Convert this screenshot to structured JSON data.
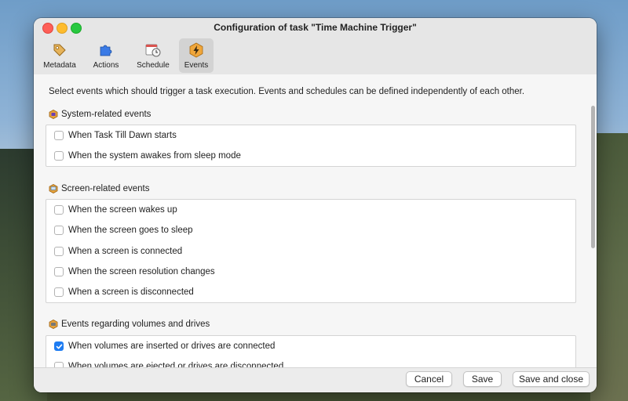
{
  "window": {
    "title": "Configuration of task \"Time Machine Trigger\""
  },
  "tabs": [
    {
      "label": "Metadata",
      "icon": "tag-icon"
    },
    {
      "label": "Actions",
      "icon": "puzzle-icon"
    },
    {
      "label": "Schedule",
      "icon": "calendar-clock-icon"
    },
    {
      "label": "Events",
      "icon": "lightning-icon",
      "active": true
    }
  ],
  "intro": "Select events which should trigger a task execution. Events and schedules can be defined independently of each other.",
  "sections": [
    {
      "title": "System-related events",
      "items": [
        {
          "label": "When Task Till Dawn starts",
          "checked": false
        },
        {
          "label": "When the system awakes from sleep mode",
          "checked": false
        }
      ]
    },
    {
      "title": "Screen-related events",
      "items": [
        {
          "label": "When the screen wakes up",
          "checked": false
        },
        {
          "label": "When the screen goes to sleep",
          "checked": false
        },
        {
          "label": "When a screen is connected",
          "checked": false
        },
        {
          "label": "When the screen resolution changes",
          "checked": false
        },
        {
          "label": "When a screen is disconnected",
          "checked": false
        }
      ]
    },
    {
      "title": "Events regarding volumes and drives",
      "items": [
        {
          "label": "When volumes are inserted or drives are connected",
          "checked": true
        },
        {
          "label": "When volumes are ejected or drives are disconnected",
          "checked": false
        }
      ]
    }
  ],
  "footer": {
    "cancel": "Cancel",
    "save": "Save",
    "save_close": "Save and close"
  },
  "colors": {
    "accent": "#1e7cf2",
    "section_icon": "#e8a33a"
  }
}
